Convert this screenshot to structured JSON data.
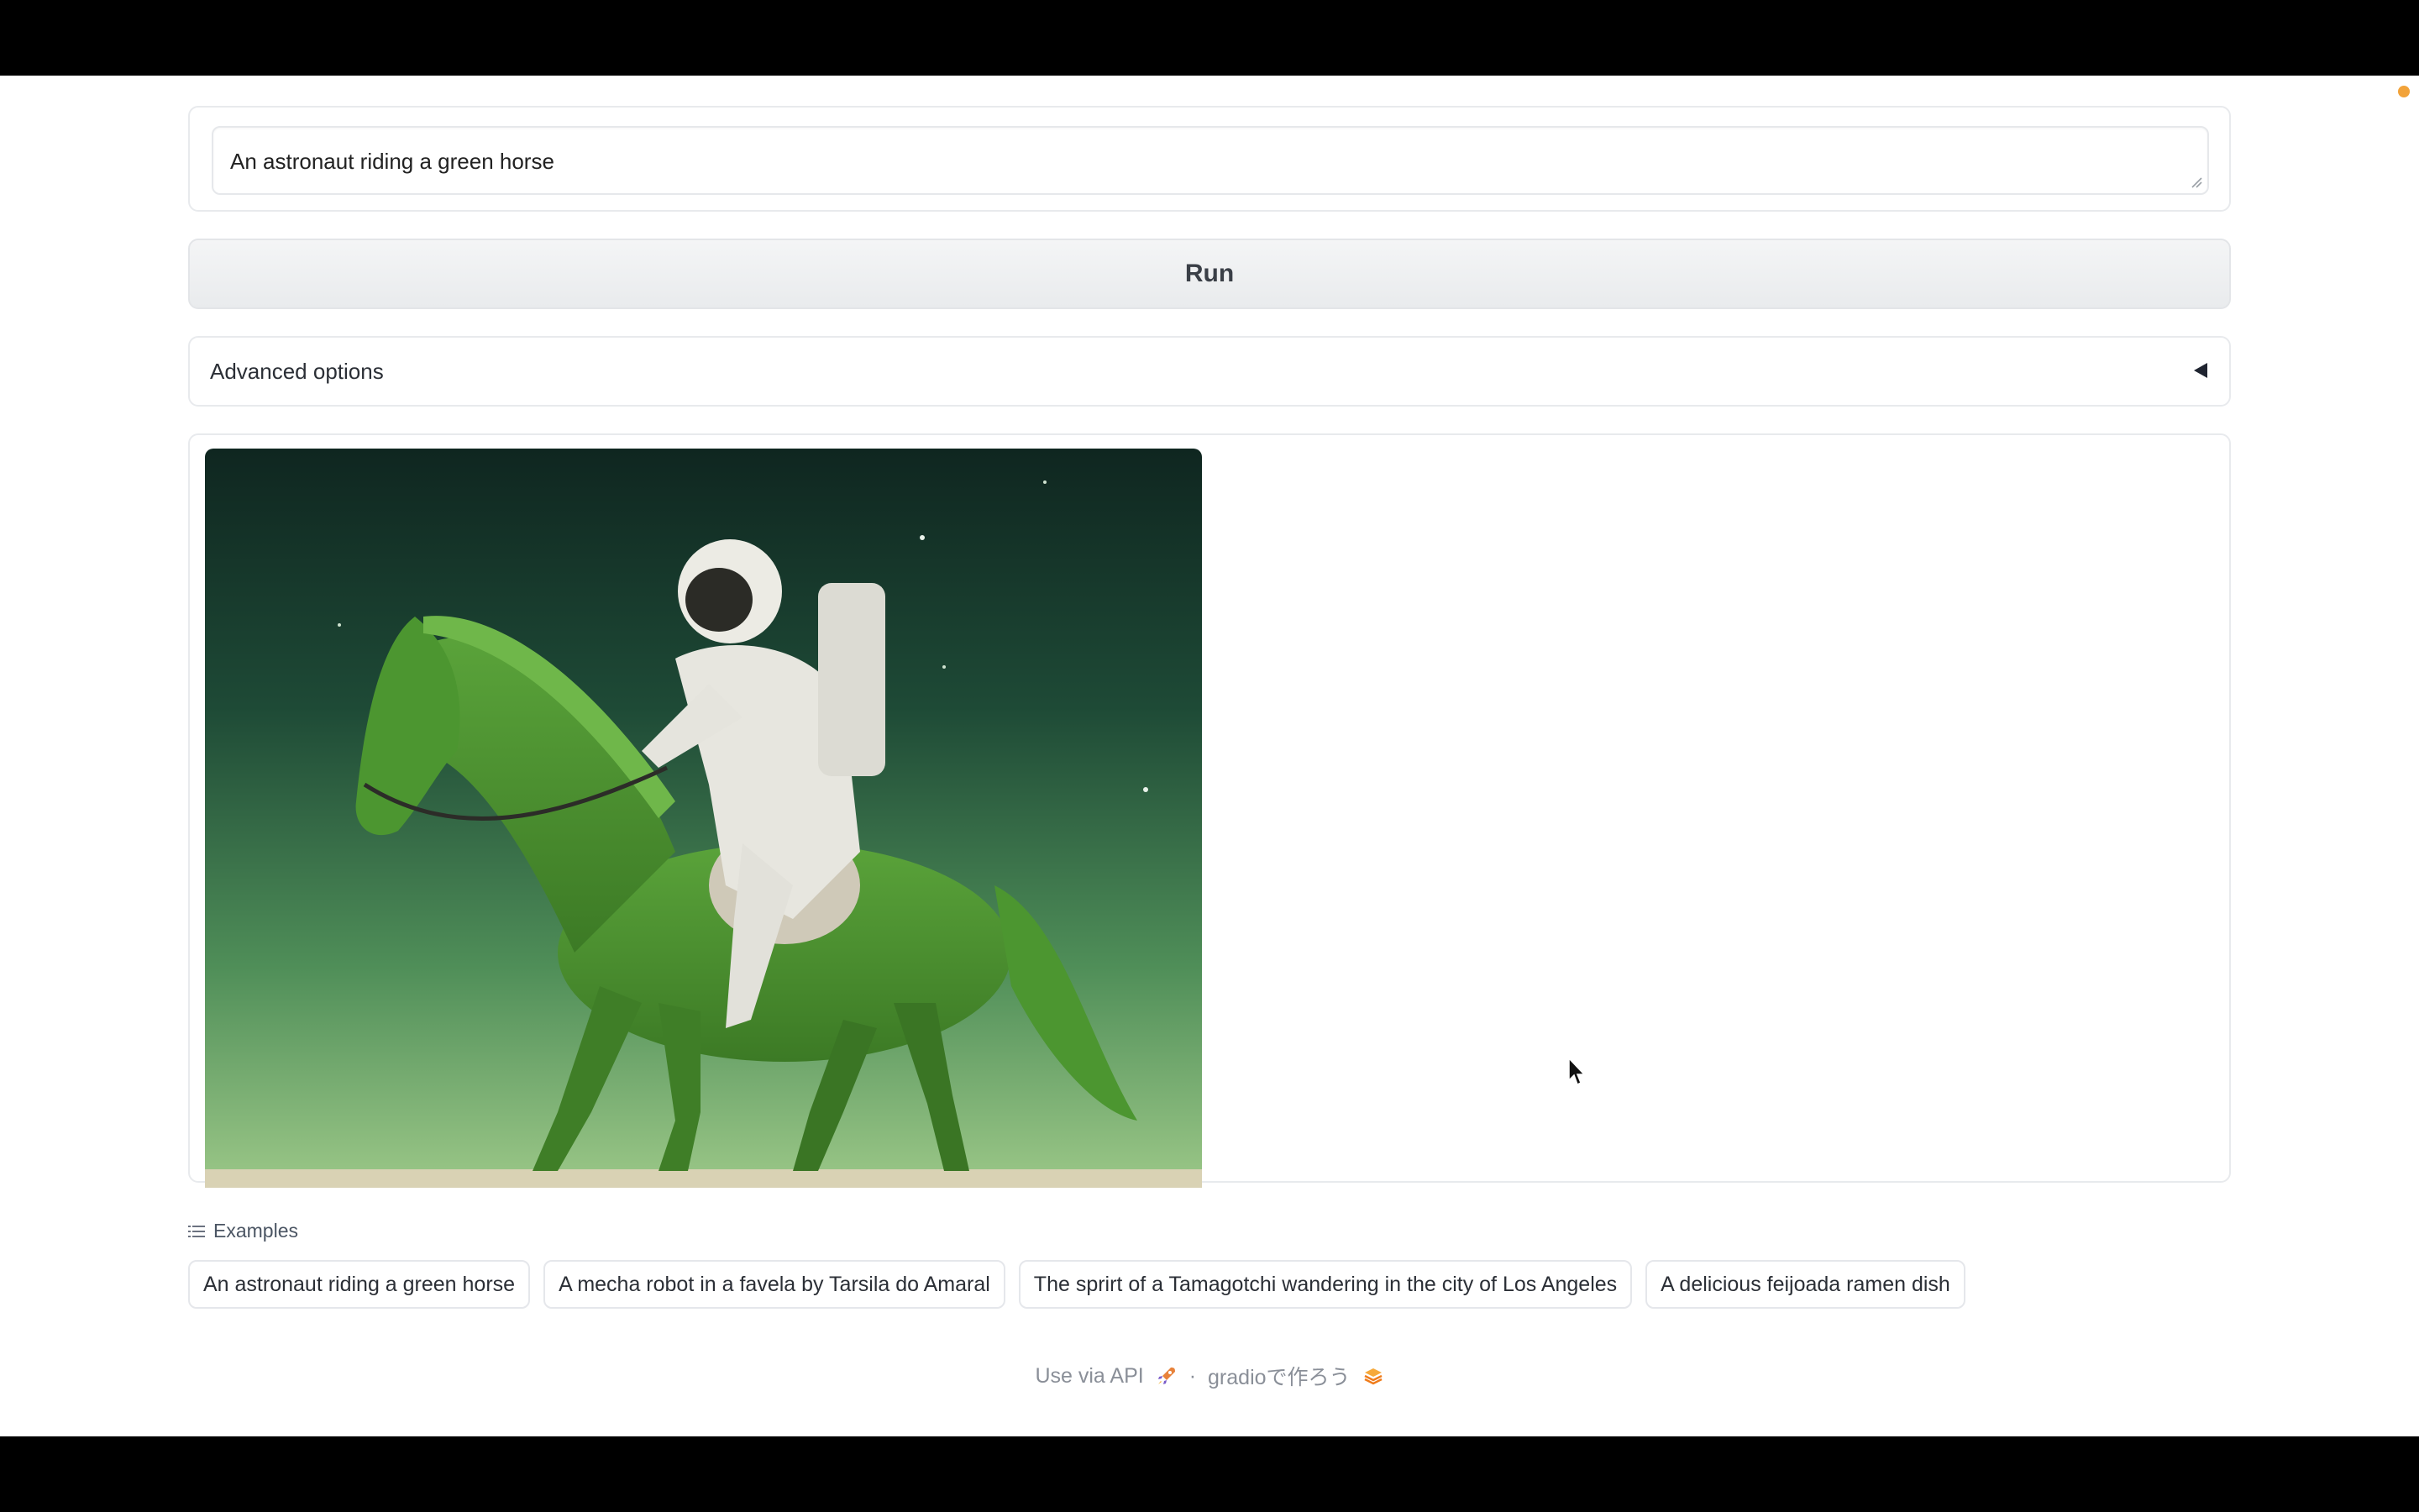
{
  "prompt": {
    "value": "An astronaut riding a green horse"
  },
  "run_button": {
    "label": "Run"
  },
  "advanced": {
    "label": "Advanced options",
    "caret_icon": "triangle-left-icon"
  },
  "gallery": {
    "image_description_icon": "generated-image"
  },
  "examples": {
    "header": "Examples",
    "header_icon": "list-icon",
    "items": [
      "An astronaut riding a green horse",
      "A mecha robot in a favela by Tarsila do Amaral",
      "The sprirt of a Tamagotchi wandering in the city of Los Angeles",
      "A delicious feijoada ramen dish"
    ]
  },
  "footer": {
    "api_label": "Use via API",
    "api_icon": "rocket-icon",
    "separator": "·",
    "built_with_label": "gradioで作ろう",
    "built_with_icon": "gradio-logo-icon"
  },
  "colors": {
    "status_dot": "#f2a33a",
    "accent_green": "#5c9a3a"
  }
}
